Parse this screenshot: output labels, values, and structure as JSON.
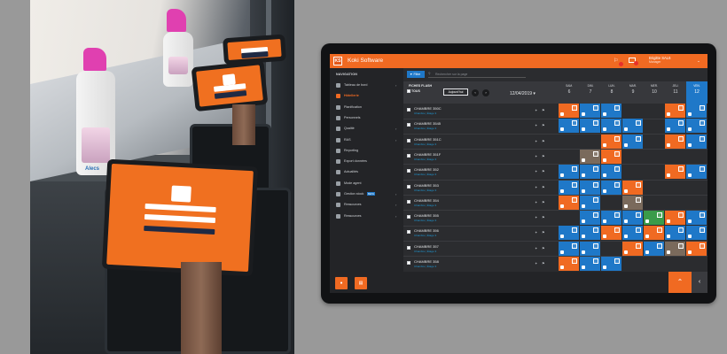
{
  "app": {
    "title": "Koki Software",
    "logo_text": "KS",
    "user_name": "Brigitte SAL6",
    "user_role": "Manager"
  },
  "colors": {
    "accent": "#f06a22",
    "blue": "#1f78c8",
    "grey": "#7a6a5c",
    "green": "#3a9b4a",
    "dark": "#2b2c2f"
  },
  "sidebar": {
    "heading": "NAVIGATION",
    "items": [
      {
        "label": "Tableau de bord",
        "icon": "dashboard-icon",
        "chevron": true,
        "active": false
      },
      {
        "label": "Hôtellerie",
        "icon": "bed-icon",
        "chevron": false,
        "active": true
      },
      {
        "label": "Planification",
        "icon": "calendar-icon",
        "chevron": false,
        "active": false
      },
      {
        "label": "Personnels",
        "icon": "people-icon",
        "chevron": false,
        "active": false
      },
      {
        "label": "Qualité",
        "icon": "star-icon",
        "chevron": true,
        "active": false
      },
      {
        "label": "RAS",
        "icon": "check-icon",
        "chevron": true,
        "active": false
      },
      {
        "label": "Reporting",
        "icon": "chart-icon",
        "chevron": false,
        "active": false
      },
      {
        "label": "Export données",
        "icon": "export-icon",
        "chevron": false,
        "active": false
      },
      {
        "label": "Actualités",
        "icon": "news-icon",
        "chevron": false,
        "active": false
      },
      {
        "label": "Mode agent",
        "icon": "agent-icon",
        "chevron": false,
        "active": false
      },
      {
        "label": "Gestion stock",
        "icon": "box-icon",
        "chevron": true,
        "active": false,
        "badge": "BETA"
      },
      {
        "label": "Ressources",
        "icon": "folder-icon",
        "chevron": true,
        "active": false
      },
      {
        "label": "Ressources",
        "icon": "folder-icon",
        "chevron": true,
        "active": false
      }
    ]
  },
  "toolbar": {
    "filter_label": "Filtre",
    "search_placeholder": "Rechercher sur la page"
  },
  "grid": {
    "section_label": "FICHES FLASH",
    "all_label": "TOUS",
    "today_label": "Aujourd'hui",
    "date": "12/04/2019",
    "days": [
      {
        "d": "SAM.",
        "n": "6"
      },
      {
        "d": "DIM.",
        "n": "7"
      },
      {
        "d": "LUN.",
        "n": "8"
      },
      {
        "d": "MAR.",
        "n": "9"
      },
      {
        "d": "MER.",
        "n": "10"
      },
      {
        "d": "JEU.",
        "n": "11"
      },
      {
        "d": "VEN.",
        "n": "12"
      }
    ],
    "rows": [
      {
        "name": "CHAMBRE 350C",
        "sub": "Chambre | Étage 3",
        "cells": [
          "o",
          "b",
          "b",
          "",
          "",
          "o",
          "b"
        ]
      },
      {
        "name": "CHAMBRE 3545",
        "sub": "Chambre | Étage 3",
        "cells": [
          "b",
          "b",
          "b",
          "b",
          "",
          "b",
          "b"
        ]
      },
      {
        "name": "CHAMBRE 351C",
        "sub": "Chambre | Étage 3",
        "cells": [
          "",
          "",
          "o",
          "b",
          "",
          "o",
          "b"
        ]
      },
      {
        "name": "CHAMBRE 351F",
        "sub": "Chambre | Étage 3",
        "cells": [
          "",
          "g",
          "o",
          "",
          "",
          "",
          ""
        ]
      },
      {
        "name": "CHAMBRE 352",
        "sub": "Chambre | Étage 3",
        "cells": [
          "b",
          "b",
          "b",
          "",
          "",
          "o",
          "b"
        ]
      },
      {
        "name": "CHAMBRE 353",
        "sub": "Chambre | Étage 3",
        "cells": [
          "b",
          "b",
          "b",
          "o",
          "",
          "",
          ""
        ]
      },
      {
        "name": "CHAMBRE 354",
        "sub": "Chambre | Étage 3",
        "cells": [
          "o",
          "b",
          "",
          "g",
          "",
          "",
          ""
        ]
      },
      {
        "name": "CHAMBRE 355",
        "sub": "Chambre | Étage 3",
        "cells": [
          "",
          "b",
          "b",
          "b",
          "gr",
          "o",
          "b"
        ]
      },
      {
        "name": "CHAMBRE 356",
        "sub": "Chambre | Étage 3",
        "cells": [
          "b",
          "b",
          "o",
          "b",
          "o",
          "b",
          "b"
        ]
      },
      {
        "name": "CHAMBRE 357",
        "sub": "Chambre | Étage 3",
        "cells": [
          "b",
          "b",
          "",
          "o",
          "b",
          "g",
          "o"
        ]
      },
      {
        "name": "CHAMBRE 358",
        "sub": "Chambre | Étage 3",
        "cells": [
          "o",
          "b",
          "b",
          "",
          "",
          "",
          ""
        ]
      }
    ]
  },
  "photo": {
    "bottle_brand": "Alecs",
    "tablet_logo": "KS"
  }
}
